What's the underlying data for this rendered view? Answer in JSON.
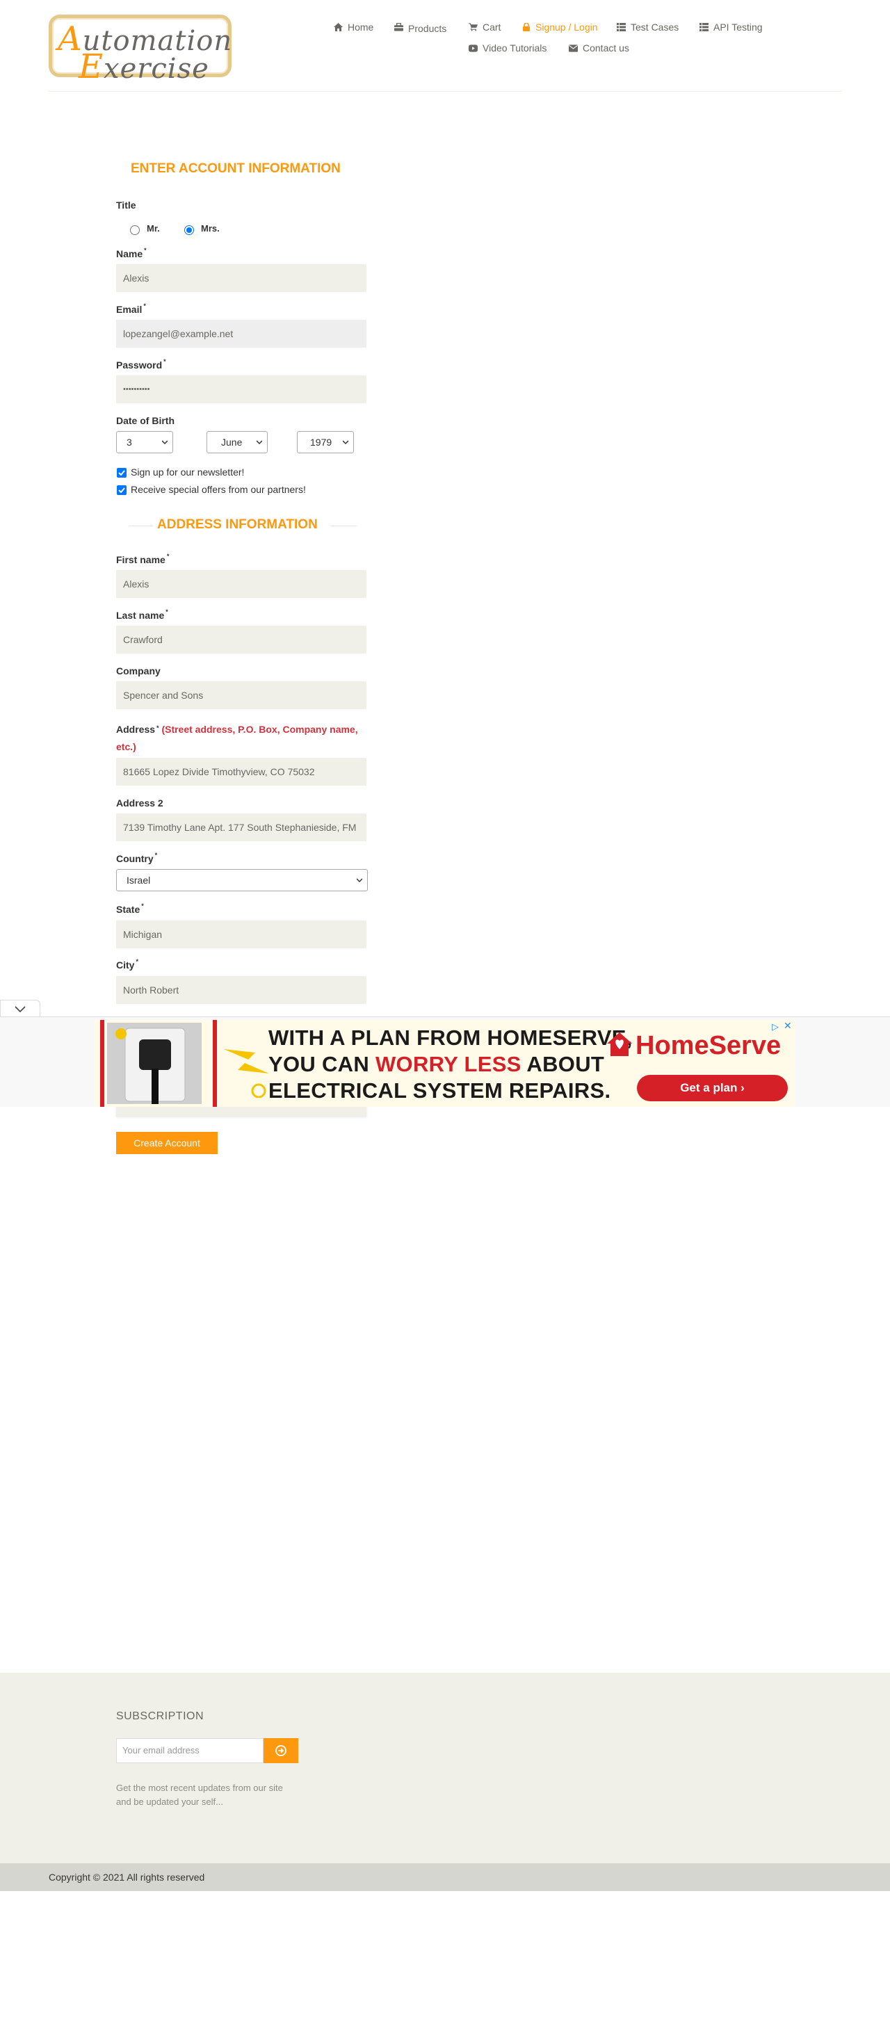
{
  "header": {
    "logo_line1_cap": "A",
    "logo_line1_rest": "utomation",
    "logo_line2_cap": "E",
    "logo_line2_rest": "xercise",
    "nav": {
      "home": "Home",
      "products": "Products",
      "cart": "Cart",
      "signup_login": "Signup / Login",
      "test_cases": "Test Cases",
      "api_testing": "API Testing",
      "video_tutorials": "Video Tutorials",
      "contact_us": "Contact us"
    }
  },
  "account": {
    "section_title": "ENTER ACCOUNT INFORMATION",
    "title_label": "Title",
    "title_options": [
      "Mr.",
      "Mrs."
    ],
    "title_selected": "Mrs.",
    "name_label": "Name",
    "name_value": "Alexis",
    "email_label": "Email",
    "email_value": "lopezangel@example.net",
    "password_label": "Password",
    "password_value": "••••••••••",
    "dob_label": "Date of Birth",
    "dob_day": "3",
    "dob_month": "June",
    "dob_year": "1979",
    "newsletter_label": "Sign up for our newsletter!",
    "newsletter_checked": true,
    "offers_label": "Receive special offers from our partners!",
    "offers_checked": true
  },
  "address": {
    "section_title": "ADDRESS INFORMATION",
    "first_name_label": "First name",
    "first_name_value": "Alexis",
    "last_name_label": "Last name",
    "last_name_value": "Crawford",
    "company_label": "Company",
    "company_value": "Spencer and Sons",
    "address_label": "Address",
    "address_hint": "(Street address, P.O. Box, Company name, etc.)",
    "address_value": "81665 Lopez Divide Timothyview, CO 75032",
    "address2_label": "Address 2",
    "address2_value": "7139 Timothy Lane Apt. 177 South Stephanieside, FM",
    "country_label": "Country",
    "country_value": "Israel",
    "state_label": "State",
    "state_value": "Michigan",
    "city_label": "City",
    "city_value": "North Robert",
    "required_mark": "*"
  },
  "create_button": "Create Account",
  "ad": {
    "line1": "WITH A PLAN FROM HOMESERVE,",
    "line2_pre": "YOU CAN ",
    "line2_highlight": "WORRY LESS",
    "line2_post": " ABOUT",
    "line3": "ELECTRICAL  SYSTEM REPAIRS.",
    "brand": "HomeServe",
    "cta": "Get a plan ›",
    "info_icon": "▷",
    "close_icon": "✕"
  },
  "footer": {
    "subscription_title": "SUBSCRIPTION",
    "email_placeholder": "Your email address",
    "subscription_text": "Get the most recent updates from our site and be updated your self...",
    "copyright": "Copyright © 2021 All rights reserved"
  },
  "colors": {
    "accent": "#fe980f",
    "field_bg": "#f0f0e9",
    "hint_red": "#d0323c"
  }
}
